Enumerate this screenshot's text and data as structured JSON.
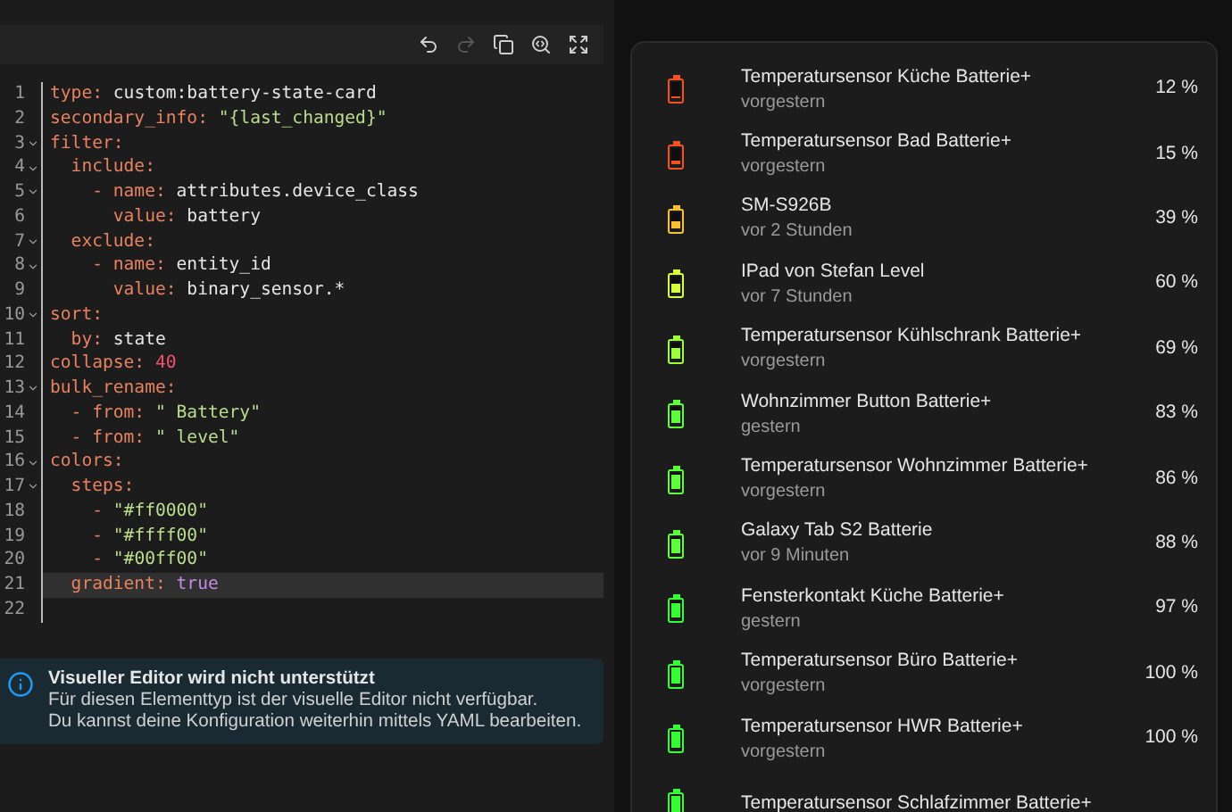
{
  "toolbar": [
    {
      "kind": "undo",
      "disabled": false
    },
    {
      "kind": "redo",
      "disabled": true
    },
    {
      "kind": "copy",
      "disabled": false
    },
    {
      "kind": "search",
      "disabled": false
    },
    {
      "kind": "expand",
      "disabled": false
    }
  ],
  "code_lines": [
    {
      "number": "1",
      "foldable": false,
      "active": false,
      "tokens": [
        {
          "kind": "key",
          "text": "type:"
        },
        {
          "kind": "plain",
          "text": " custom:battery-state-card"
        }
      ]
    },
    {
      "number": "2",
      "foldable": false,
      "active": false,
      "tokens": [
        {
          "kind": "key",
          "text": "secondary_info:"
        },
        {
          "kind": "string",
          "text": " \"{last_changed}\""
        }
      ]
    },
    {
      "number": "3",
      "foldable": true,
      "active": false,
      "tokens": [
        {
          "kind": "key",
          "text": "filter:"
        }
      ]
    },
    {
      "number": "4",
      "foldable": true,
      "active": false,
      "tokens": [
        {
          "kind": "key",
          "text": "  include:"
        }
      ]
    },
    {
      "number": "5",
      "foldable": true,
      "active": false,
      "tokens": [
        {
          "kind": "key",
          "text": "    - name:"
        },
        {
          "kind": "plain",
          "text": " attributes.device_class"
        }
      ]
    },
    {
      "number": "6",
      "foldable": false,
      "active": false,
      "tokens": [
        {
          "kind": "key",
          "text": "      value:"
        },
        {
          "kind": "plain",
          "text": " battery"
        }
      ]
    },
    {
      "number": "7",
      "foldable": true,
      "active": false,
      "tokens": [
        {
          "kind": "key",
          "text": "  exclude:"
        }
      ]
    },
    {
      "number": "8",
      "foldable": true,
      "active": false,
      "tokens": [
        {
          "kind": "key",
          "text": "    - name:"
        },
        {
          "kind": "plain",
          "text": " entity_id"
        }
      ]
    },
    {
      "number": "9",
      "foldable": false,
      "active": false,
      "tokens": [
        {
          "kind": "key",
          "text": "      value:"
        },
        {
          "kind": "plain",
          "text": " binary_sensor.*"
        }
      ]
    },
    {
      "number": "10",
      "foldable": true,
      "active": false,
      "tokens": [
        {
          "kind": "key",
          "text": "sort:"
        }
      ]
    },
    {
      "number": "11",
      "foldable": false,
      "active": false,
      "tokens": [
        {
          "kind": "key",
          "text": "  by:"
        },
        {
          "kind": "plain",
          "text": " state"
        }
      ]
    },
    {
      "number": "12",
      "foldable": false,
      "active": false,
      "tokens": [
        {
          "kind": "key",
          "text": "collapse:"
        },
        {
          "kind": "number",
          "text": " 40"
        }
      ]
    },
    {
      "number": "13",
      "foldable": true,
      "active": false,
      "tokens": [
        {
          "kind": "key",
          "text": "bulk_rename:"
        }
      ]
    },
    {
      "number": "14",
      "foldable": false,
      "active": false,
      "tokens": [
        {
          "kind": "key",
          "text": "  - from:"
        },
        {
          "kind": "string",
          "text": " \" Battery\""
        }
      ]
    },
    {
      "number": "15",
      "foldable": false,
      "active": false,
      "tokens": [
        {
          "kind": "key",
          "text": "  - from:"
        },
        {
          "kind": "string",
          "text": " \" level\""
        }
      ]
    },
    {
      "number": "16",
      "foldable": true,
      "active": false,
      "tokens": [
        {
          "kind": "key",
          "text": "colors:"
        }
      ]
    },
    {
      "number": "17",
      "foldable": true,
      "active": false,
      "tokens": [
        {
          "kind": "key",
          "text": "  steps:"
        }
      ]
    },
    {
      "number": "18",
      "foldable": false,
      "active": false,
      "tokens": [
        {
          "kind": "key",
          "text": "    -"
        },
        {
          "kind": "string",
          "text": " \"#ff0000\""
        }
      ]
    },
    {
      "number": "19",
      "foldable": false,
      "active": false,
      "tokens": [
        {
          "kind": "key",
          "text": "    -"
        },
        {
          "kind": "string",
          "text": " \"#ffff00\""
        }
      ]
    },
    {
      "number": "20",
      "foldable": false,
      "active": false,
      "tokens": [
        {
          "kind": "key",
          "text": "    -"
        },
        {
          "kind": "string",
          "text": " \"#00ff00\""
        }
      ]
    },
    {
      "number": "21",
      "foldable": false,
      "active": true,
      "tokens": [
        {
          "kind": "key",
          "text": "  gradient:"
        },
        {
          "kind": "bool",
          "text": " true"
        }
      ]
    },
    {
      "number": "22",
      "foldable": false,
      "active": false
    }
  ],
  "notice": {
    "title": "Visueller Editor wird nicht unterstützt",
    "lines": [
      "Für diesen Elementtyp ist der visuelle Editor nicht verfügbar.",
      "Du kannst deine Konfiguration weiterhin mittels YAML bearbeiten."
    ]
  },
  "batteries": [
    {
      "name": "Temperatursensor Küche Batterie+",
      "info": "vorgestern",
      "value": "12 %",
      "color": "#f4511e",
      "level": 0.12
    },
    {
      "name": "Temperatursensor Bad Batterie+",
      "info": "vorgestern",
      "value": "15 %",
      "color": "#f4511e",
      "level": 0.15
    },
    {
      "name": "SM-S926B",
      "info": "vor 2 Stunden",
      "value": "39 %",
      "color": "#fbc02d",
      "level": 0.39
    },
    {
      "name": "IPad von Stefan Level",
      "info": "vor 7 Stunden",
      "value": "60 %",
      "color": "#d4ff3a",
      "level": 0.6
    },
    {
      "name": "Temperatursensor Kühlschrank Batterie+",
      "info": "vorgestern",
      "value": "69 %",
      "color": "#9cff3a",
      "level": 0.69
    },
    {
      "name": "Wohnzimmer Button Batterie+",
      "info": "gestern",
      "value": "83 %",
      "color": "#5cff3a",
      "level": 0.83
    },
    {
      "name": "Temperatursensor Wohnzimmer Batterie+",
      "info": "vorgestern",
      "value": "86 %",
      "color": "#5cff3a",
      "level": 0.86
    },
    {
      "name": "Galaxy Tab S2 Batterie",
      "info": "vor 9 Minuten",
      "value": "88 %",
      "color": "#5cff3a",
      "level": 0.88
    },
    {
      "name": "Fensterkontakt Küche Batterie+",
      "info": "gestern",
      "value": "97 %",
      "color": "#33ff33",
      "level": 0.97
    },
    {
      "name": "Temperatursensor Büro Batterie+",
      "info": "vorgestern",
      "value": "100 %",
      "color": "#33ff33",
      "level": 1
    },
    {
      "name": "Temperatursensor HWR Batterie+",
      "info": "vorgestern",
      "value": "100 %",
      "color": "#33ff33",
      "level": 1
    },
    {
      "name": "Temperatursensor Schlafzimmer Batterie+",
      "color": "#33ff33",
      "level": 1
    }
  ]
}
